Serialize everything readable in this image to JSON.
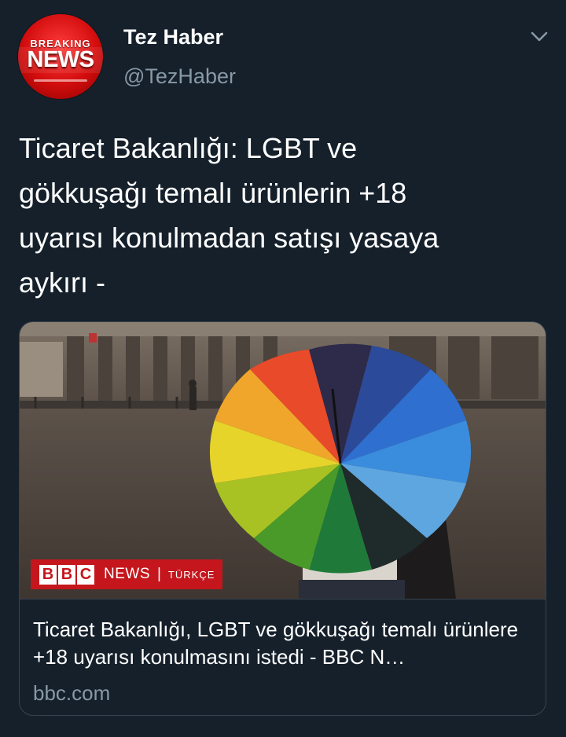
{
  "author": {
    "avatar_top_text": "BREAKING",
    "avatar_main_text": "NEWS",
    "name": "Tez Haber",
    "handle": "@TezHaber"
  },
  "tweet": {
    "text": "Ticaret Bakanlığı: LGBT ve\ngökkuşağı temalı ürünlerin +18\nuyarısı konulmadan satışı yasaya\naykırı -"
  },
  "card": {
    "badge": {
      "letters": [
        "B",
        "B",
        "C"
      ],
      "news": "NEWS",
      "separator": "|",
      "language": "TÜRKÇE"
    },
    "title": "Ticaret Bakanlığı, LGBT ve gökkuşağı temalı ürünlere +18 uyarısı konulmasını istedi - BBC N…",
    "domain": "bbc.com"
  },
  "colors": {
    "background": "#15202b",
    "secondary_text": "#8899a6",
    "border": "#38444d",
    "bbc_red": "#c4161c"
  },
  "icons": {
    "menu": "chevron-down-icon"
  }
}
